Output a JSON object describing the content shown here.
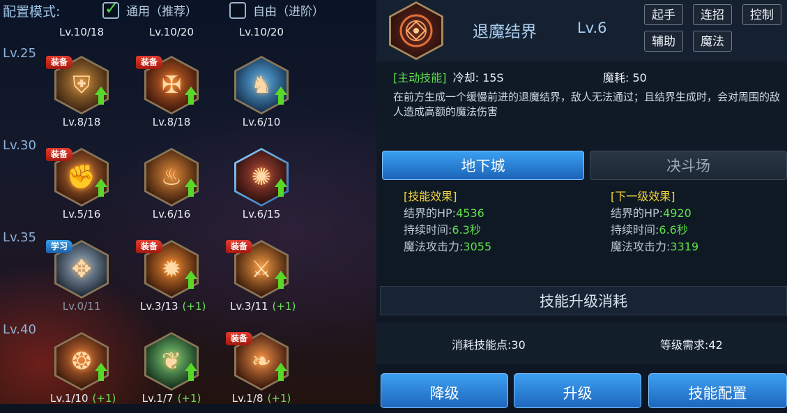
{
  "config": {
    "label": "配置模式:",
    "options": [
      {
        "label": "通用（推荐）",
        "checked": true
      },
      {
        "label": "自由（进阶）",
        "checked": false
      }
    ]
  },
  "top_levels": [
    "Lv.10/18",
    "Lv.10/20",
    "Lv.10/20"
  ],
  "tiers": [
    {
      "label": "Lv.25",
      "skills": [
        {
          "icon": "helmet-icon",
          "glyph": "⛨",
          "tag": "装备",
          "tag_type": "equip",
          "upgradable": true,
          "level": "Lv.8/18",
          "bonus": "",
          "dim": false,
          "colors": [
            "#c58a3c",
            "#3a2312"
          ]
        },
        {
          "icon": "cross-sword-icon",
          "glyph": "✠",
          "tag": "装备",
          "tag_type": "equip",
          "upgradable": true,
          "level": "Lv.8/18",
          "bonus": "",
          "dim": false,
          "colors": [
            "#d86a28",
            "#3c170c"
          ]
        },
        {
          "icon": "shield-figure-icon",
          "glyph": "♞",
          "tag": "",
          "tag_type": "",
          "upgradable": true,
          "level": "Lv.6/10",
          "bonus": "",
          "dim": false,
          "colors": [
            "#5fb4ef",
            "#15324f"
          ]
        }
      ]
    },
    {
      "label": "Lv.30",
      "skills": [
        {
          "icon": "fist-icon",
          "glyph": "✊",
          "tag": "装备",
          "tag_type": "equip",
          "upgradable": true,
          "level": "Lv.5/16",
          "bonus": "",
          "dim": false,
          "colors": [
            "#d07a3a",
            "#3a1a0c"
          ]
        },
        {
          "icon": "whirlwind-icon",
          "glyph": "♨",
          "tag": "",
          "tag_type": "",
          "upgradable": true,
          "level": "Lv.6/16",
          "bonus": "",
          "dim": false,
          "colors": [
            "#e08a3a",
            "#3a1c0c"
          ]
        },
        {
          "icon": "barrier-rune-icon",
          "glyph": "✺",
          "tag": "",
          "tag_type": "",
          "upgradable": true,
          "level": "Lv.6/15",
          "bonus": "",
          "dim": false,
          "selected": true,
          "colors": [
            "#b0483a",
            "#2a0f0c"
          ]
        }
      ]
    },
    {
      "label": "Lv.35",
      "skills": [
        {
          "icon": "wings-icon",
          "glyph": "✥",
          "tag": "学习",
          "tag_type": "learn",
          "upgradable": false,
          "level": "Lv.0/11",
          "bonus": "",
          "dim": true,
          "colors": [
            "#9fb3c8",
            "#1f2a36"
          ]
        },
        {
          "icon": "sun-burst-icon",
          "glyph": "✹",
          "tag": "装备",
          "tag_type": "equip",
          "upgradable": true,
          "level": "Lv.3/13",
          "bonus": "(+1)",
          "dim": false,
          "colors": [
            "#f08a34",
            "#3a1a0a"
          ]
        },
        {
          "icon": "flame-sword-icon",
          "glyph": "⚔",
          "tag": "装备",
          "tag_type": "equip",
          "upgradable": true,
          "level": "Lv.3/11",
          "bonus": "(+1)",
          "dim": false,
          "colors": [
            "#f09a44",
            "#3a1a0a"
          ]
        }
      ]
    },
    {
      "label": "Lv.40",
      "skills": [
        {
          "icon": "swirl-icon",
          "glyph": "❂",
          "tag": "",
          "tag_type": "",
          "upgradable": true,
          "level": "Lv.1/10",
          "bonus": "(+1)",
          "dim": false,
          "colors": [
            "#e07a3a",
            "#3a180c"
          ]
        },
        {
          "icon": "angel-icon",
          "glyph": "❦",
          "tag": "",
          "tag_type": "",
          "upgradable": true,
          "level": "Lv.1/7",
          "bonus": "(+1)",
          "dim": false,
          "colors": [
            "#7fd47a",
            "#14301c"
          ]
        },
        {
          "icon": "phoenix-icon",
          "glyph": "❧",
          "tag": "装备",
          "tag_type": "equip",
          "upgradable": true,
          "level": "Lv.1/8",
          "bonus": "(+1)",
          "dim": false,
          "colors": [
            "#f0904a",
            "#3a160a"
          ]
        }
      ]
    }
  ],
  "detail": {
    "icon": "barrier-rune-icon",
    "name": "退魔结界",
    "level": "Lv.6",
    "tags": [
      "起手",
      "连招",
      "控制",
      "辅助",
      "魔法"
    ],
    "skill_type": "[主动技能]",
    "cooldown": "冷却: 15S",
    "mana": "魔耗: 50",
    "description": "在前方生成一个缓慢前进的退魔结界，敌人无法通过；且结界生成时，会对周围的敌人造成高额的魔法伤害"
  },
  "tabs": {
    "active": "地下城",
    "inactive": "决斗场"
  },
  "effects": {
    "current": {
      "title": "[技能效果]",
      "rows": [
        {
          "key": "结界的HP:",
          "value": "4536"
        },
        {
          "key": "持续时间:",
          "value": "6.3秒"
        },
        {
          "key": "魔法攻击力:",
          "value": "3055"
        }
      ]
    },
    "next": {
      "title": "[下一级效果]",
      "rows": [
        {
          "key": "结界的HP:",
          "value": "4920"
        },
        {
          "key": "持续时间:",
          "value": "6.6秒"
        },
        {
          "key": "魔法攻击力:",
          "value": "3319"
        }
      ]
    }
  },
  "cost": {
    "header": "技能升级消耗",
    "points": "消耗技能点:30",
    "requirement": "等级需求:42"
  },
  "actions": {
    "downgrade": "降级",
    "upgrade": "升级",
    "config": "技能配置"
  },
  "colors": {
    "accent_blue": "#2a84d8",
    "green_value": "#5ee04a",
    "yellow_title": "#f0d23a",
    "equip_tag": "#d42a1e",
    "learn_tag": "#2b86d6"
  }
}
